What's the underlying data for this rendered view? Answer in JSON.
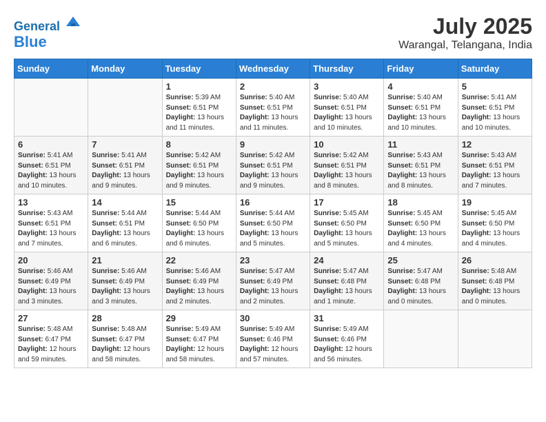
{
  "header": {
    "logo_line1": "General",
    "logo_line2": "Blue",
    "month_year": "July 2025",
    "location": "Warangal, Telangana, India"
  },
  "weekdays": [
    "Sunday",
    "Monday",
    "Tuesday",
    "Wednesday",
    "Thursday",
    "Friday",
    "Saturday"
  ],
  "weeks": [
    [
      {
        "day": "",
        "info": ""
      },
      {
        "day": "",
        "info": ""
      },
      {
        "day": "1",
        "info": "Sunrise: 5:39 AM\nSunset: 6:51 PM\nDaylight: 13 hours and 11 minutes."
      },
      {
        "day": "2",
        "info": "Sunrise: 5:40 AM\nSunset: 6:51 PM\nDaylight: 13 hours and 11 minutes."
      },
      {
        "day": "3",
        "info": "Sunrise: 5:40 AM\nSunset: 6:51 PM\nDaylight: 13 hours and 10 minutes."
      },
      {
        "day": "4",
        "info": "Sunrise: 5:40 AM\nSunset: 6:51 PM\nDaylight: 13 hours and 10 minutes."
      },
      {
        "day": "5",
        "info": "Sunrise: 5:41 AM\nSunset: 6:51 PM\nDaylight: 13 hours and 10 minutes."
      }
    ],
    [
      {
        "day": "6",
        "info": "Sunrise: 5:41 AM\nSunset: 6:51 PM\nDaylight: 13 hours and 10 minutes."
      },
      {
        "day": "7",
        "info": "Sunrise: 5:41 AM\nSunset: 6:51 PM\nDaylight: 13 hours and 9 minutes."
      },
      {
        "day": "8",
        "info": "Sunrise: 5:42 AM\nSunset: 6:51 PM\nDaylight: 13 hours and 9 minutes."
      },
      {
        "day": "9",
        "info": "Sunrise: 5:42 AM\nSunset: 6:51 PM\nDaylight: 13 hours and 9 minutes."
      },
      {
        "day": "10",
        "info": "Sunrise: 5:42 AM\nSunset: 6:51 PM\nDaylight: 13 hours and 8 minutes."
      },
      {
        "day": "11",
        "info": "Sunrise: 5:43 AM\nSunset: 6:51 PM\nDaylight: 13 hours and 8 minutes."
      },
      {
        "day": "12",
        "info": "Sunrise: 5:43 AM\nSunset: 6:51 PM\nDaylight: 13 hours and 7 minutes."
      }
    ],
    [
      {
        "day": "13",
        "info": "Sunrise: 5:43 AM\nSunset: 6:51 PM\nDaylight: 13 hours and 7 minutes."
      },
      {
        "day": "14",
        "info": "Sunrise: 5:44 AM\nSunset: 6:51 PM\nDaylight: 13 hours and 6 minutes."
      },
      {
        "day": "15",
        "info": "Sunrise: 5:44 AM\nSunset: 6:50 PM\nDaylight: 13 hours and 6 minutes."
      },
      {
        "day": "16",
        "info": "Sunrise: 5:44 AM\nSunset: 6:50 PM\nDaylight: 13 hours and 5 minutes."
      },
      {
        "day": "17",
        "info": "Sunrise: 5:45 AM\nSunset: 6:50 PM\nDaylight: 13 hours and 5 minutes."
      },
      {
        "day": "18",
        "info": "Sunrise: 5:45 AM\nSunset: 6:50 PM\nDaylight: 13 hours and 4 minutes."
      },
      {
        "day": "19",
        "info": "Sunrise: 5:45 AM\nSunset: 6:50 PM\nDaylight: 13 hours and 4 minutes."
      }
    ],
    [
      {
        "day": "20",
        "info": "Sunrise: 5:46 AM\nSunset: 6:49 PM\nDaylight: 13 hours and 3 minutes."
      },
      {
        "day": "21",
        "info": "Sunrise: 5:46 AM\nSunset: 6:49 PM\nDaylight: 13 hours and 3 minutes."
      },
      {
        "day": "22",
        "info": "Sunrise: 5:46 AM\nSunset: 6:49 PM\nDaylight: 13 hours and 2 minutes."
      },
      {
        "day": "23",
        "info": "Sunrise: 5:47 AM\nSunset: 6:49 PM\nDaylight: 13 hours and 2 minutes."
      },
      {
        "day": "24",
        "info": "Sunrise: 5:47 AM\nSunset: 6:48 PM\nDaylight: 13 hours and 1 minute."
      },
      {
        "day": "25",
        "info": "Sunrise: 5:47 AM\nSunset: 6:48 PM\nDaylight: 13 hours and 0 minutes."
      },
      {
        "day": "26",
        "info": "Sunrise: 5:48 AM\nSunset: 6:48 PM\nDaylight: 13 hours and 0 minutes."
      }
    ],
    [
      {
        "day": "27",
        "info": "Sunrise: 5:48 AM\nSunset: 6:47 PM\nDaylight: 12 hours and 59 minutes."
      },
      {
        "day": "28",
        "info": "Sunrise: 5:48 AM\nSunset: 6:47 PM\nDaylight: 12 hours and 58 minutes."
      },
      {
        "day": "29",
        "info": "Sunrise: 5:49 AM\nSunset: 6:47 PM\nDaylight: 12 hours and 58 minutes."
      },
      {
        "day": "30",
        "info": "Sunrise: 5:49 AM\nSunset: 6:46 PM\nDaylight: 12 hours and 57 minutes."
      },
      {
        "day": "31",
        "info": "Sunrise: 5:49 AM\nSunset: 6:46 PM\nDaylight: 12 hours and 56 minutes."
      },
      {
        "day": "",
        "info": ""
      },
      {
        "day": "",
        "info": ""
      }
    ]
  ]
}
